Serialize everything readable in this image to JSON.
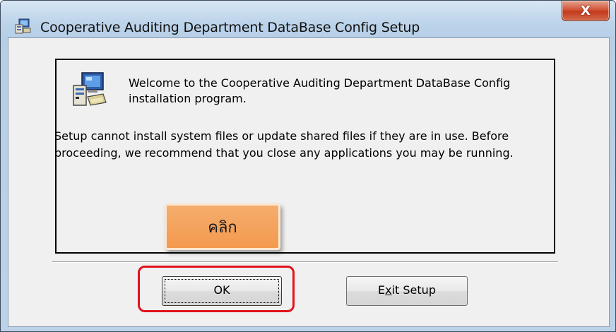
{
  "window": {
    "title": "Cooperative Auditing Department DataBase Config Setup",
    "close_label": "X"
  },
  "panel": {
    "welcome_text": "Welcome to the Cooperative Auditing Department DataBase Config installation program.",
    "warning_text": "Setup cannot install system files or update shared files if they are in use. Before proceeding, we recommend that you close any applications you may be running."
  },
  "buttons": {
    "ok_label": "OK",
    "exit_prefix": "E",
    "exit_mnemonic": "x",
    "exit_suffix": "it Setup"
  },
  "annotation": {
    "callout_text": "คลิก",
    "highlight_color": "#e2121e",
    "callout_color": "#f39a4f"
  },
  "icons": [
    "setup-app-icon",
    "close-icon",
    "computer-setup-icon"
  ]
}
